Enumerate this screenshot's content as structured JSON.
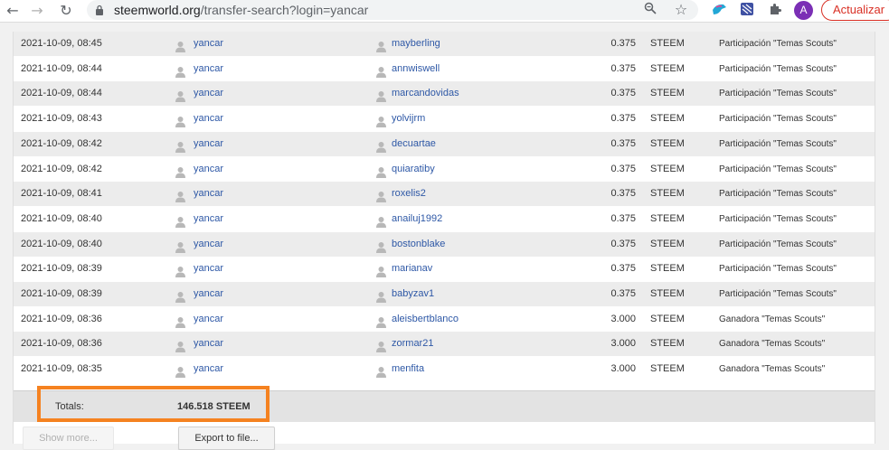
{
  "browser": {
    "url_host": "steemworld.org",
    "url_path": "/transfer-search?login=yancar",
    "avatar_letter": "A",
    "update_label": "Actualizar"
  },
  "transfers": [
    {
      "date": "2021-10-09, 08:45",
      "from": "yancar",
      "to": "mayberling",
      "amount": "0.375",
      "currency": "STEEM",
      "memo": "Participación \"Temas Scouts\""
    },
    {
      "date": "2021-10-09, 08:44",
      "from": "yancar",
      "to": "annwiswell",
      "amount": "0.375",
      "currency": "STEEM",
      "memo": "Participación \"Temas Scouts\""
    },
    {
      "date": "2021-10-09, 08:44",
      "from": "yancar",
      "to": "marcandovidas",
      "amount": "0.375",
      "currency": "STEEM",
      "memo": "Participación \"Temas Scouts\""
    },
    {
      "date": "2021-10-09, 08:43",
      "from": "yancar",
      "to": "yolvijrm",
      "amount": "0.375",
      "currency": "STEEM",
      "memo": "Participación \"Temas Scouts\""
    },
    {
      "date": "2021-10-09, 08:42",
      "from": "yancar",
      "to": "decuartae",
      "amount": "0.375",
      "currency": "STEEM",
      "memo": "Participación \"Temas Scouts\""
    },
    {
      "date": "2021-10-09, 08:42",
      "from": "yancar",
      "to": "quiaratiby",
      "amount": "0.375",
      "currency": "STEEM",
      "memo": "Participación \"Temas Scouts\""
    },
    {
      "date": "2021-10-09, 08:41",
      "from": "yancar",
      "to": "roxelis2",
      "amount": "0.375",
      "currency": "STEEM",
      "memo": "Participación \"Temas Scouts\""
    },
    {
      "date": "2021-10-09, 08:40",
      "from": "yancar",
      "to": "anailuj1992",
      "amount": "0.375",
      "currency": "STEEM",
      "memo": "Participación \"Temas Scouts\""
    },
    {
      "date": "2021-10-09, 08:40",
      "from": "yancar",
      "to": "bostonblake",
      "amount": "0.375",
      "currency": "STEEM",
      "memo": "Participación \"Temas Scouts\""
    },
    {
      "date": "2021-10-09, 08:39",
      "from": "yancar",
      "to": "marianav",
      "amount": "0.375",
      "currency": "STEEM",
      "memo": "Participación \"Temas Scouts\""
    },
    {
      "date": "2021-10-09, 08:39",
      "from": "yancar",
      "to": "babyzav1",
      "amount": "0.375",
      "currency": "STEEM",
      "memo": "Participación \"Temas Scouts\""
    },
    {
      "date": "2021-10-09, 08:36",
      "from": "yancar",
      "to": "aleisbertblanco",
      "amount": "3.000",
      "currency": "STEEM",
      "memo": "Ganadora \"Temas Scouts\""
    },
    {
      "date": "2021-10-09, 08:36",
      "from": "yancar",
      "to": "zormar21",
      "amount": "3.000",
      "currency": "STEEM",
      "memo": "Ganadora \"Temas Scouts\""
    },
    {
      "date": "2021-10-09, 08:35",
      "from": "yancar",
      "to": "menfita",
      "amount": "3.000",
      "currency": "STEEM",
      "memo": "Ganadora \"Temas Scouts\""
    }
  ],
  "totals": {
    "label": "Totals:",
    "value": "146.518 STEEM"
  },
  "actions": {
    "show_more": "Show more...",
    "export": "Export to file..."
  },
  "colors": {
    "highlight": "#f58220",
    "link": "#2e58a6",
    "update": "#d93025",
    "avatar": "#7b2fb5"
  }
}
